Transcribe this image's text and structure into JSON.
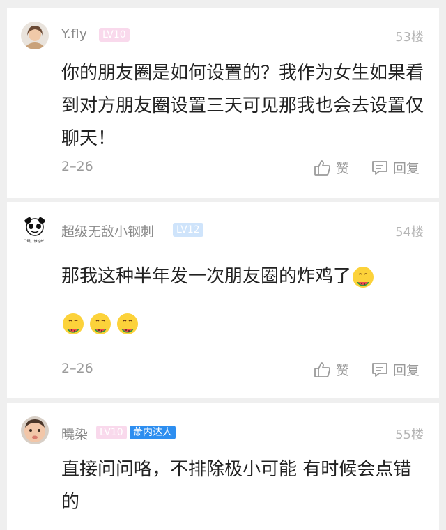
{
  "comments": [
    {
      "username": "Y.fly",
      "level": "LV10",
      "floor": "53楼",
      "text": "你的朋友圈是如何设置的？我作为女生如果看到对方朋友圈设置三天可见那我也会去设置仅聊天！",
      "date": "2–26",
      "like_label": "赞",
      "reply_label": "回复"
    },
    {
      "username": "超级无敌小钢刺",
      "level": "LV12",
      "floor": "54楼",
      "text": "那我这种半年发一次朋友圈的炸鸡了",
      "emoji_line": [
        "watermelon-emoji",
        "watermelon-emoji",
        "watermelon-emoji"
      ],
      "date": "2–26",
      "like_label": "赞",
      "reply_label": "回复"
    },
    {
      "username": "曉染",
      "level": "LV10",
      "title_badge": "萧内达人",
      "floor": "55楼",
      "text": "直接问问咯，不排除极小可能 有时候会点错的"
    }
  ],
  "avatar_caption": "我跟。谁怕谁?"
}
